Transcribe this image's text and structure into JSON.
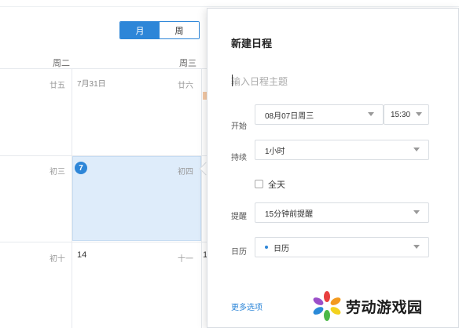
{
  "view_toggle": {
    "month": "月",
    "week": "周",
    "selected": "月"
  },
  "weekdays": {
    "tue": "周二",
    "wed": "周三"
  },
  "calendar": {
    "row1": {
      "lunar_a": "廿五",
      "date_b": "7月31日",
      "lunar_b": "廿六"
    },
    "row2": {
      "lunar_a": "初三",
      "today": "7",
      "lunar_b": "初四"
    },
    "row3": {
      "lunar_a": "初十",
      "date_b": "14",
      "lunar_b": "十一",
      "date_c": "1"
    }
  },
  "popover": {
    "title": "新建日程",
    "subject_placeholder": "输入日程主题",
    "start_label": "开始",
    "start_date": "08月07日周三",
    "start_time": "15:30",
    "duration_label": "持续",
    "duration_value": "1小时",
    "allday_label": "全天",
    "allday_checked": false,
    "reminder_label": "提醒",
    "reminder_value": "15分钟前提醒",
    "calendar_label": "日历",
    "calendar_value": "日历",
    "more_options": "更多选项"
  },
  "watermark": {
    "text": "劳动游戏园"
  },
  "colors": {
    "accent": "#2d86d8",
    "selected_cell": "#deecfa"
  }
}
